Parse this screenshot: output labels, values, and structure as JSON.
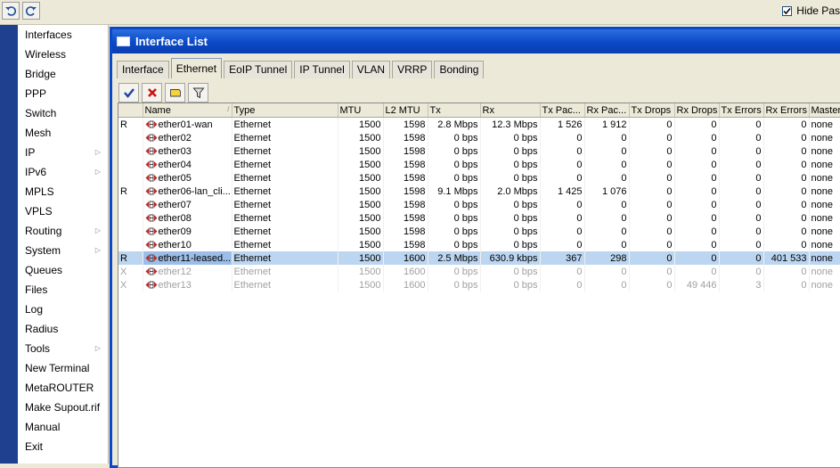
{
  "top_toolbar": {
    "undo_icon": "undo-icon",
    "redo_icon": "redo-icon",
    "hide_passwords_label": "Hide Pas",
    "hide_passwords_checked": true
  },
  "sidebar": {
    "items": [
      {
        "label": "Interfaces",
        "submenu": false
      },
      {
        "label": "Wireless",
        "submenu": false
      },
      {
        "label": "Bridge",
        "submenu": false
      },
      {
        "label": "PPP",
        "submenu": false
      },
      {
        "label": "Switch",
        "submenu": false
      },
      {
        "label": "Mesh",
        "submenu": false
      },
      {
        "label": "IP",
        "submenu": true
      },
      {
        "label": "IPv6",
        "submenu": true
      },
      {
        "label": "MPLS",
        "submenu": false
      },
      {
        "label": "VPLS",
        "submenu": false
      },
      {
        "label": "Routing",
        "submenu": true
      },
      {
        "label": "System",
        "submenu": true
      },
      {
        "label": "Queues",
        "submenu": false
      },
      {
        "label": "Files",
        "submenu": false
      },
      {
        "label": "Log",
        "submenu": false
      },
      {
        "label": "Radius",
        "submenu": false
      },
      {
        "label": "Tools",
        "submenu": true
      },
      {
        "label": "New Terminal",
        "submenu": false
      },
      {
        "label": "MetaROUTER",
        "submenu": false
      },
      {
        "label": "Make Supout.rif",
        "submenu": false
      },
      {
        "label": "Manual",
        "submenu": false
      },
      {
        "label": "Exit",
        "submenu": false
      }
    ]
  },
  "window": {
    "title": "Interface List",
    "tabs": [
      "Interface",
      "Ethernet",
      "EoIP Tunnel",
      "IP Tunnel",
      "VLAN",
      "VRRP",
      "Bonding"
    ],
    "active_tab": "Ethernet",
    "actions": [
      "enable-icon",
      "disable-icon",
      "comment-icon",
      "filter-icon"
    ]
  },
  "table": {
    "columns": [
      "",
      "Name",
      "Type",
      "MTU",
      "L2 MTU",
      "Tx",
      "Rx",
      "Tx Pac...",
      "Rx Pac...",
      "Tx Drops",
      "Rx Drops",
      "Tx Errors",
      "Rx Errors",
      "Master"
    ],
    "rows": [
      {
        "flag": "R",
        "name": "ether01-wan",
        "type": "Ethernet",
        "mtu": "1500",
        "l2mtu": "1598",
        "tx": "2.8 Mbps",
        "rx": "12.3 Mbps",
        "txp": "1 526",
        "rxp": "1 912",
        "txd": "0",
        "rxd": "0",
        "txe": "0",
        "rxe": "0",
        "master": "none",
        "state": "normal"
      },
      {
        "flag": "",
        "name": "ether02",
        "type": "Ethernet",
        "mtu": "1500",
        "l2mtu": "1598",
        "tx": "0 bps",
        "rx": "0 bps",
        "txp": "0",
        "rxp": "0",
        "txd": "0",
        "rxd": "0",
        "txe": "0",
        "rxe": "0",
        "master": "none",
        "state": "normal"
      },
      {
        "flag": "",
        "name": "ether03",
        "type": "Ethernet",
        "mtu": "1500",
        "l2mtu": "1598",
        "tx": "0 bps",
        "rx": "0 bps",
        "txp": "0",
        "rxp": "0",
        "txd": "0",
        "rxd": "0",
        "txe": "0",
        "rxe": "0",
        "master": "none",
        "state": "normal"
      },
      {
        "flag": "",
        "name": "ether04",
        "type": "Ethernet",
        "mtu": "1500",
        "l2mtu": "1598",
        "tx": "0 bps",
        "rx": "0 bps",
        "txp": "0",
        "rxp": "0",
        "txd": "0",
        "rxd": "0",
        "txe": "0",
        "rxe": "0",
        "master": "none",
        "state": "normal"
      },
      {
        "flag": "",
        "name": "ether05",
        "type": "Ethernet",
        "mtu": "1500",
        "l2mtu": "1598",
        "tx": "0 bps",
        "rx": "0 bps",
        "txp": "0",
        "rxp": "0",
        "txd": "0",
        "rxd": "0",
        "txe": "0",
        "rxe": "0",
        "master": "none",
        "state": "normal"
      },
      {
        "flag": "R",
        "name": "ether06-lan_cli...",
        "type": "Ethernet",
        "mtu": "1500",
        "l2mtu": "1598",
        "tx": "9.1 Mbps",
        "rx": "2.0 Mbps",
        "txp": "1 425",
        "rxp": "1 076",
        "txd": "0",
        "rxd": "0",
        "txe": "0",
        "rxe": "0",
        "master": "none",
        "state": "normal"
      },
      {
        "flag": "",
        "name": "ether07",
        "type": "Ethernet",
        "mtu": "1500",
        "l2mtu": "1598",
        "tx": "0 bps",
        "rx": "0 bps",
        "txp": "0",
        "rxp": "0",
        "txd": "0",
        "rxd": "0",
        "txe": "0",
        "rxe": "0",
        "master": "none",
        "state": "normal"
      },
      {
        "flag": "",
        "name": "ether08",
        "type": "Ethernet",
        "mtu": "1500",
        "l2mtu": "1598",
        "tx": "0 bps",
        "rx": "0 bps",
        "txp": "0",
        "rxp": "0",
        "txd": "0",
        "rxd": "0",
        "txe": "0",
        "rxe": "0",
        "master": "none",
        "state": "normal"
      },
      {
        "flag": "",
        "name": "ether09",
        "type": "Ethernet",
        "mtu": "1500",
        "l2mtu": "1598",
        "tx": "0 bps",
        "rx": "0 bps",
        "txp": "0",
        "rxp": "0",
        "txd": "0",
        "rxd": "0",
        "txe": "0",
        "rxe": "0",
        "master": "none",
        "state": "normal"
      },
      {
        "flag": "",
        "name": "ether10",
        "type": "Ethernet",
        "mtu": "1500",
        "l2mtu": "1598",
        "tx": "0 bps",
        "rx": "0 bps",
        "txp": "0",
        "rxp": "0",
        "txd": "0",
        "rxd": "0",
        "txe": "0",
        "rxe": "0",
        "master": "none",
        "state": "normal"
      },
      {
        "flag": "R",
        "name": "ether11-leased...",
        "type": "Ethernet",
        "mtu": "1500",
        "l2mtu": "1600",
        "tx": "2.5 Mbps",
        "rx": "630.9 kbps",
        "txp": "367",
        "rxp": "298",
        "txd": "0",
        "rxd": "0",
        "txe": "0",
        "rxe": "401 533",
        "master": "none",
        "state": "selected"
      },
      {
        "flag": "X",
        "name": "ether12",
        "type": "Ethernet",
        "mtu": "1500",
        "l2mtu": "1600",
        "tx": "0 bps",
        "rx": "0 bps",
        "txp": "0",
        "rxp": "0",
        "txd": "0",
        "rxd": "0",
        "txe": "0",
        "rxe": "0",
        "master": "none",
        "state": "disabled"
      },
      {
        "flag": "X",
        "name": "ether13",
        "type": "Ethernet",
        "mtu": "1500",
        "l2mtu": "1600",
        "tx": "0 bps",
        "rx": "0 bps",
        "txp": "0",
        "rxp": "0",
        "txd": "0",
        "rxd": "49 446",
        "txe": "3",
        "rxe": "0",
        "master": "none",
        "state": "disabled"
      }
    ]
  },
  "colors": {
    "title_blue": "#0a48c6",
    "selected_row": "#bcd5f0",
    "sidebar_strip": "#1f3f8f"
  }
}
